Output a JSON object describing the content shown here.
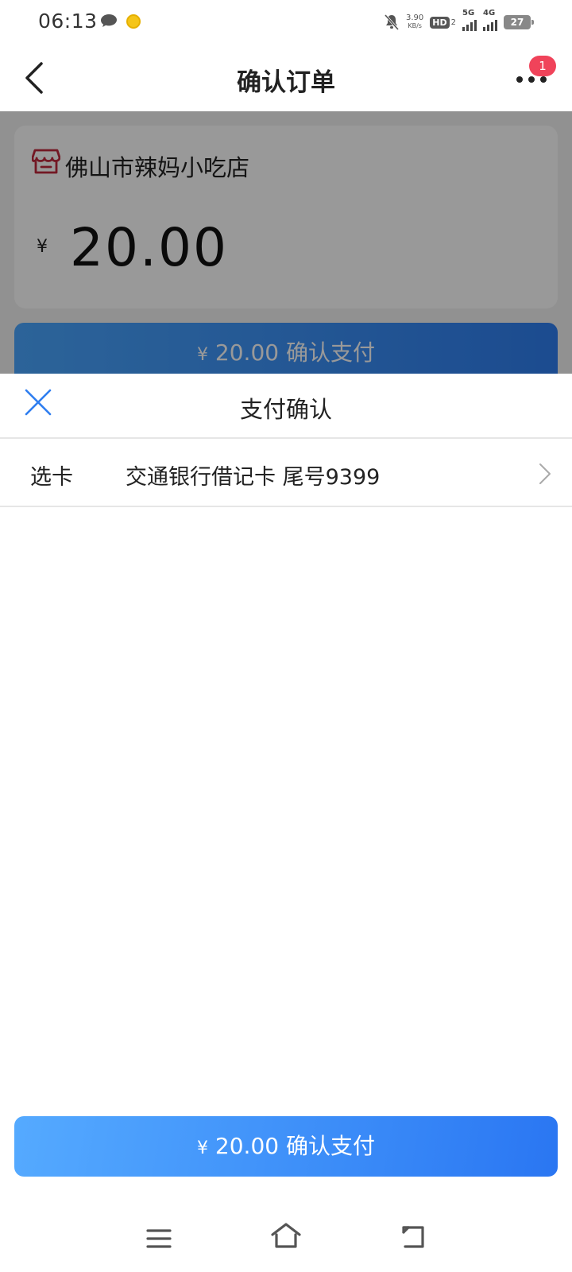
{
  "status_bar": {
    "time": "06:13",
    "net_speed_value": "3.90",
    "net_speed_unit": "KB/s",
    "hd_label": "HD",
    "hd_sub": "2",
    "net1_label": "5G",
    "net2_label": "4G",
    "battery": "27"
  },
  "nav": {
    "title": "确认订单",
    "badge_count": "1"
  },
  "order": {
    "store_name": "佛山市辣妈小吃店",
    "currency": "¥",
    "amount": "20.00"
  },
  "background_pay_button": {
    "currency": "¥",
    "label": "20.00 确认支付"
  },
  "sheet": {
    "title": "支付确认",
    "card_label": "选卡",
    "card_value": "交通银行借记卡 尾号9399"
  },
  "confirm_button": {
    "currency": "¥",
    "label": "20.00 确认支付"
  },
  "colors": {
    "accent_blue": "#3b8cf8",
    "store_icon_red": "#c0283c",
    "badge_red": "#f0435a",
    "close_icon_blue": "#2f7ef0"
  },
  "icons": {
    "back": "chevron-left-icon",
    "more": "more-dots-icon",
    "store": "store-icon",
    "close": "close-icon",
    "chevron": "chevron-right-icon",
    "sys_menu": "menu-icon",
    "sys_home": "home-icon",
    "sys_back": "back-icon"
  }
}
